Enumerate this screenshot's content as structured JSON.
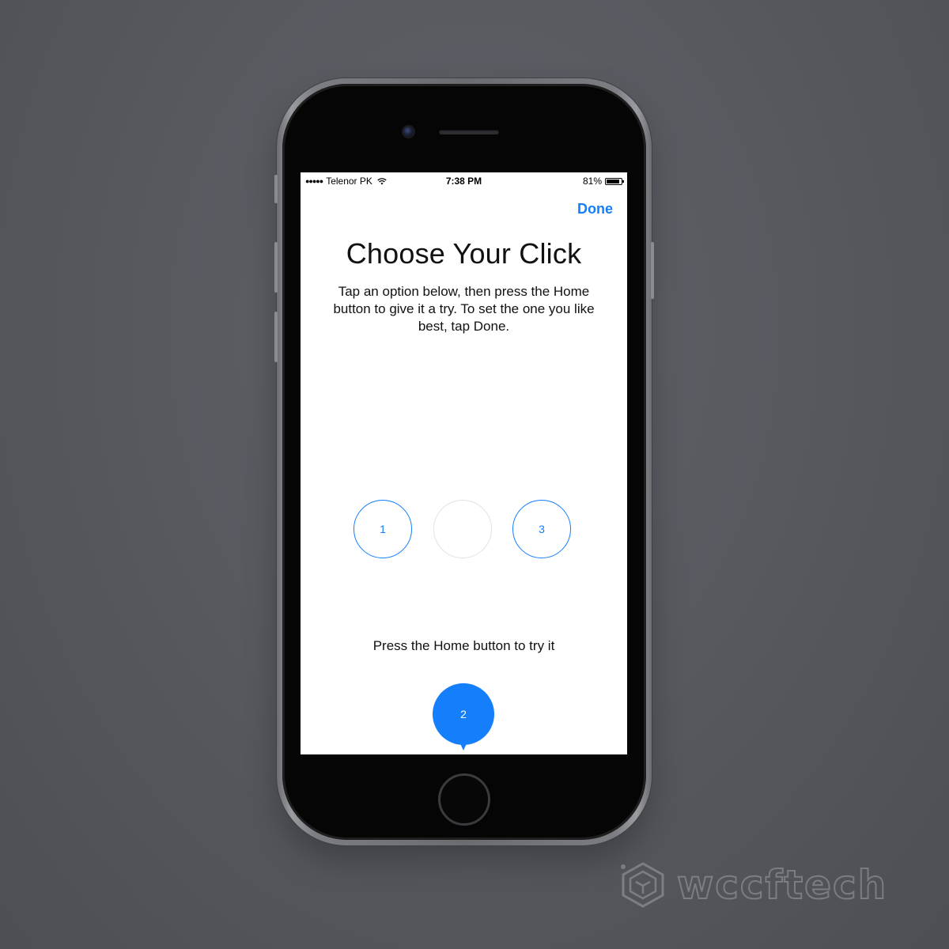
{
  "status_bar": {
    "signal": "●●●●●",
    "carrier": "Telenor PK",
    "time": "7:38 PM",
    "battery_percent": "81%",
    "battery_level": 0.81,
    "icons": [
      "signal-icon",
      "wifi-icon",
      "battery-icon"
    ]
  },
  "nav": {
    "done_label": "Done"
  },
  "content": {
    "title": "Choose Your Click",
    "instructions": "Tap an option below, then press the Home button to give it a try. To set the one you like best, tap Done.",
    "options": [
      {
        "label": "1",
        "state": "unselected"
      },
      {
        "label": "",
        "state": "selected"
      },
      {
        "label": "3",
        "state": "unselected"
      }
    ],
    "try_prompt": "Press the Home button to try it",
    "selected_label": "2"
  },
  "watermark": {
    "text": "wccftech",
    "icon": "wccftech-logo-icon"
  },
  "colors": {
    "accent": "#147efb",
    "background": "#55585d",
    "screen": "#ffffff"
  }
}
